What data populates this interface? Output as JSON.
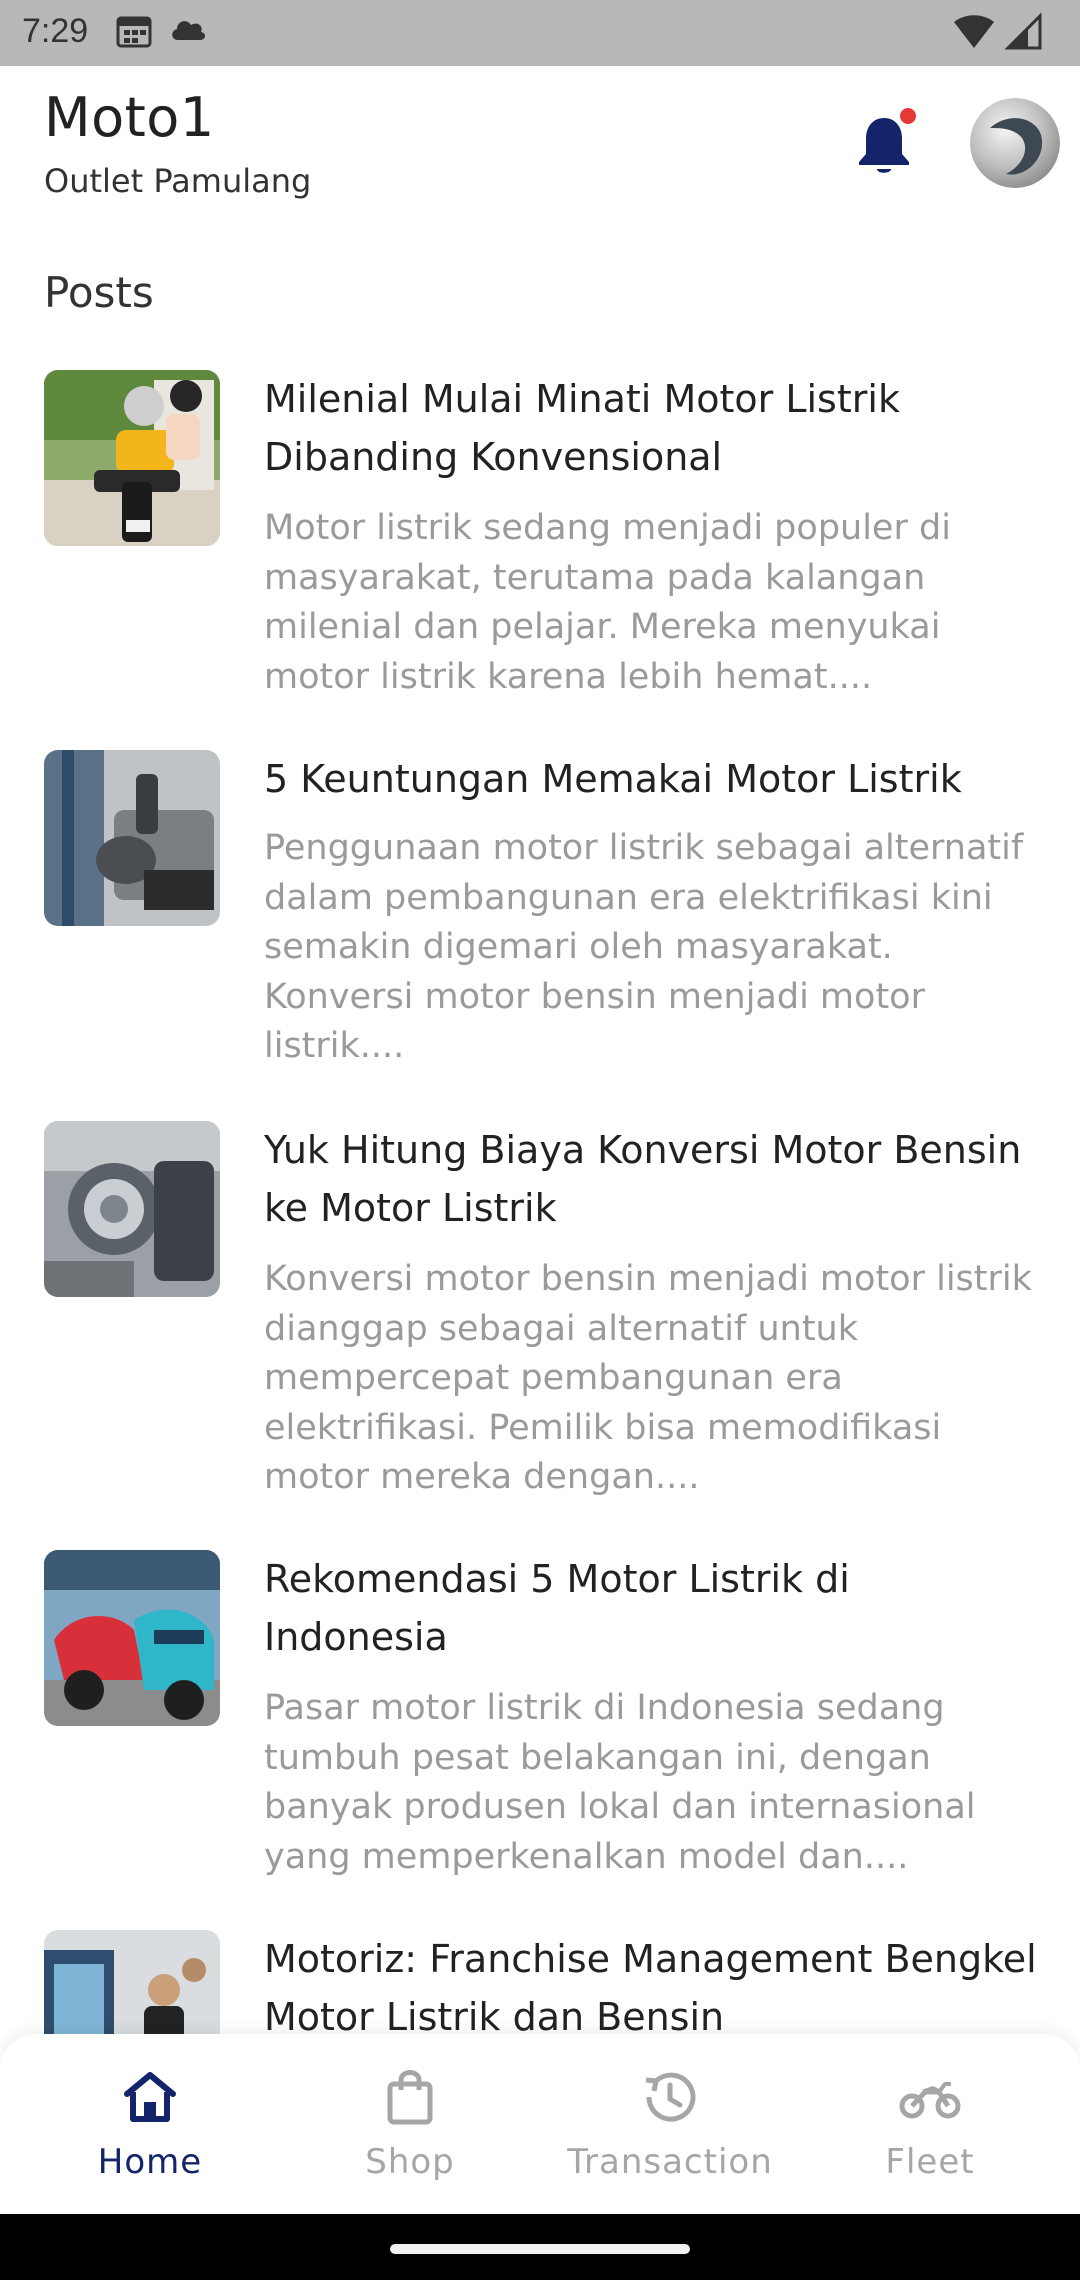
{
  "status_bar": {
    "time": "7:29",
    "left_icons": [
      "calendar-icon",
      "cloud-icon"
    ],
    "right_icons": [
      "wifi-icon",
      "signal-icon"
    ]
  },
  "header": {
    "title": "Moto1",
    "subtitle": "Outlet Pamulang",
    "notification_icon": "bell-icon",
    "notification_color": "#14246b",
    "notification_badge_color": "#e53935"
  },
  "posts_section": {
    "title": "Posts",
    "items": [
      {
        "title": "Milenial Mulai Minati Motor Listrik Dibanding Konvensional",
        "excerpt": "Motor listrik sedang menjadi populer di masyarakat, terutama pada kalangan milenial dan pelajar. Mereka menyukai motor listrik karena lebih hemat...."
      },
      {
        "title": "5 Keuntungan Memakai Motor Listrik",
        "excerpt": "Penggunaan motor listrik sebagai alternatif dalam pembangunan era elektrifikasi kini semakin digemari oleh masyarakat. Konversi motor bensin menjadi motor listrik...."
      },
      {
        "title": "Yuk Hitung Biaya Konversi Motor Bensin ke Motor Listrik",
        "excerpt": "Konversi motor bensin menjadi motor listrik dianggap sebagai alternatif untuk mempercepat pembangunan era elektrifikasi. Pemilik bisa memodifikasi motor mereka dengan...."
      },
      {
        "title": "Rekomendasi 5 Motor Listrik di Indonesia",
        "excerpt": "Pasar motor listrik di Indonesia sedang tumbuh pesat belakangan ini, dengan banyak produsen lokal dan internasional yang memperkenalkan model dan...."
      },
      {
        "title": "Motoriz: Franchise Management Bengkel Motor Listrik dan Bensin",
        "excerpt": ""
      }
    ]
  },
  "bottom_nav": {
    "active_color": "#14246b",
    "inactive_color": "#a6a6a6",
    "items": [
      {
        "label": "Home",
        "icon": "home-icon",
        "active": true
      },
      {
        "label": "Shop",
        "icon": "shopping-bag-icon",
        "active": false
      },
      {
        "label": "Transaction",
        "icon": "history-icon",
        "active": false
      },
      {
        "label": "Fleet",
        "icon": "motorcycle-icon",
        "active": false
      }
    ]
  }
}
